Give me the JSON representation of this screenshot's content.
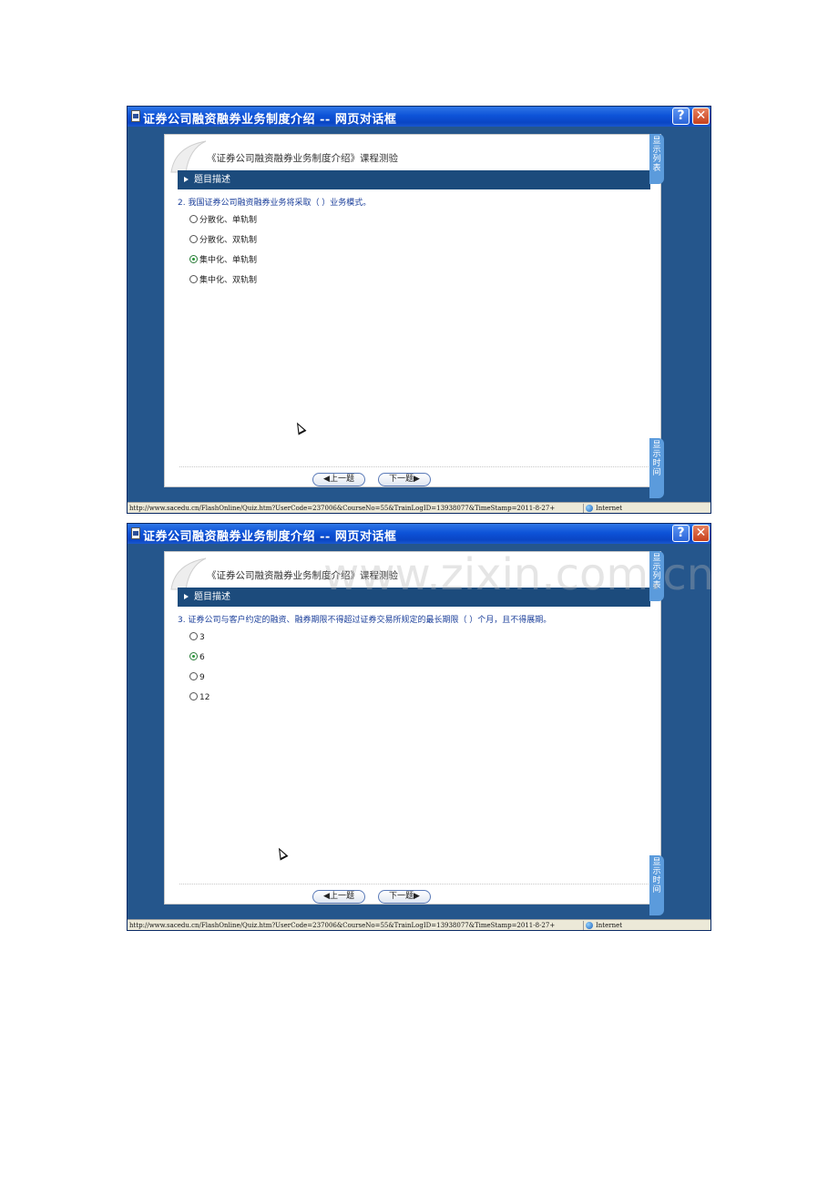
{
  "dialogs": [
    {
      "title": "证券公司融资融券业务制度介绍 -- 网页对话框",
      "help_label": "?",
      "close_label": "✕",
      "course_title": "《证券公司融资融券业务制度介绍》课程测验",
      "section_label": "题目描述",
      "question": "2. 我国证券公司融资融券业务将采取（    ）业务模式。",
      "options": [
        {
          "label": "分散化、单轨制",
          "selected": false
        },
        {
          "label": "分散化、双轨制",
          "selected": false
        },
        {
          "label": "集中化、单轨制",
          "selected": true
        },
        {
          "label": "集中化、双轨制",
          "selected": false
        }
      ],
      "prev_label": "◀上一题",
      "next_label": "下一题▶",
      "side_top_label": "显示列表",
      "side_bottom_label": "显示时间",
      "status_url": "http://www.sacedu.cn/FlashOnline/Quiz.htm?UserCode=237006&CourseNo=55&TrainLogID=13938077&TimeStamp=2011-8-27+",
      "status_zone": "Internet"
    },
    {
      "title": "证券公司融资融券业务制度介绍 -- 网页对话框",
      "help_label": "?",
      "close_label": "✕",
      "course_title": "《证券公司融资融券业务制度介绍》课程测验",
      "section_label": "题目描述",
      "question": "3. 证券公司与客户约定的融资、融券期限不得超过证券交易所规定的最长期限（    ）个月，且不得展期。",
      "options": [
        {
          "label": "3",
          "selected": false
        },
        {
          "label": "6",
          "selected": true
        },
        {
          "label": "9",
          "selected": false
        },
        {
          "label": "12",
          "selected": false
        }
      ],
      "prev_label": "◀上一题",
      "next_label": "下一题▶",
      "side_top_label": "显示列表",
      "side_bottom_label": "显示时间",
      "status_url": "http://www.sacedu.cn/FlashOnline/Quiz.htm?UserCode=237006&CourseNo=55&TrainLogID=13938077&TimeStamp=2011-8-27+",
      "status_zone": "Internet"
    }
  ],
  "watermark": "www.zixin.com.cn",
  "colors": {
    "titlebar": "#0d53d8",
    "dialog_bg": "#25568c",
    "section_bar": "#1c4b7c",
    "side_tab": "#5b9bdc",
    "question_text": "#1a3e9a",
    "selected_dot": "#2b9a3a"
  }
}
